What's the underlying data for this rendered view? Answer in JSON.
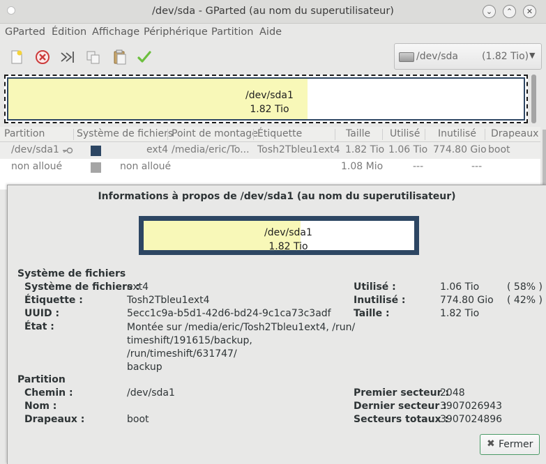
{
  "window": {
    "title": "/dev/sda - GParted (au nom du superutilisateur)",
    "minimize": "⌄",
    "maximize": "⌃",
    "close": "✕"
  },
  "menu": [
    "GParted",
    "Édition",
    "Affichage",
    "Périphérique",
    "Partition",
    "Aide"
  ],
  "toolbar": {
    "icons": [
      "new-partition-icon",
      "delete-icon",
      "resize-move-icon",
      "copy-icon",
      "paste-icon",
      "apply-icon"
    ],
    "device": {
      "name": "/dev/sda",
      "size": "(1.82 Tio)"
    }
  },
  "disk_graphic": {
    "name": "/dev/sda1",
    "size": "1.82 Tio",
    "used_fraction": 0.58
  },
  "partition_table": {
    "headers": [
      "Partition",
      "Système de fichiers",
      "Point de montage",
      "Étiquette",
      "Taille",
      "Utilisé",
      "Inutilisé",
      "Drapeaux"
    ],
    "rows": [
      {
        "partition": "/dev/sda1",
        "fs": "ext4",
        "mount": "/media/eric/To...",
        "label": "Tosh2Tbleu1ext4",
        "size": "1.82 Tio",
        "used": "1.06 Tio",
        "unused": "774.80 Gio",
        "flags": "boot",
        "color": "#2d4663"
      },
      {
        "partition": "non alloué",
        "fs": "non alloué",
        "mount": "",
        "label": "",
        "size": "1.08 Mio",
        "used": "---",
        "unused": "---",
        "flags": "",
        "color": "#a5a5a5"
      }
    ]
  },
  "dialog": {
    "title": "Informations à propos de /dev/sda1 (au nom du superutilisateur)",
    "graphic": {
      "name": "/dev/sda1",
      "size": "1.82 Tio",
      "used_fraction": 0.58
    },
    "fs_section": "Système de fichiers",
    "fs": {
      "fs_label": "Système de fichiers :",
      "fs_value": "ext4",
      "label_label": "Étiquette :",
      "label_value": "Tosh2Tbleu1ext4",
      "uuid_label": "UUID :",
      "uuid_value": "5ecc1c9a-b5d1-42d6-bd24-9c1ca73c3adf",
      "state_label": "État :",
      "state_lines": [
        "Montée sur /media/eric/Tosh2Tbleu1ext4, /run/",
        "timeshift/191615/backup, /run/timeshift/631747/",
        "backup"
      ],
      "used_label": "Utilisé :",
      "used_value": "1.06 Tio",
      "used_pct": "( 58% )",
      "unused_label": "Inutilisé :",
      "unused_value": "774.80 Gio",
      "unused_pct": "( 42% )",
      "size_label": "Taille :",
      "size_value": "1.82 Tio"
    },
    "part_section": "Partition",
    "part": {
      "path_label": "Chemin :",
      "path_value": "/dev/sda1",
      "name_label": "Nom :",
      "name_value": "",
      "flags_label": "Drapeaux :",
      "flags_value": "boot",
      "first_label": "Premier secteur :",
      "first_value": "2048",
      "last_label": "Dernier secteur :",
      "last_value": "3907026943",
      "total_label": "Secteurs totaux :",
      "total_value": "3907024896"
    },
    "close_label": "Fermer",
    "close_icon": "✖"
  }
}
